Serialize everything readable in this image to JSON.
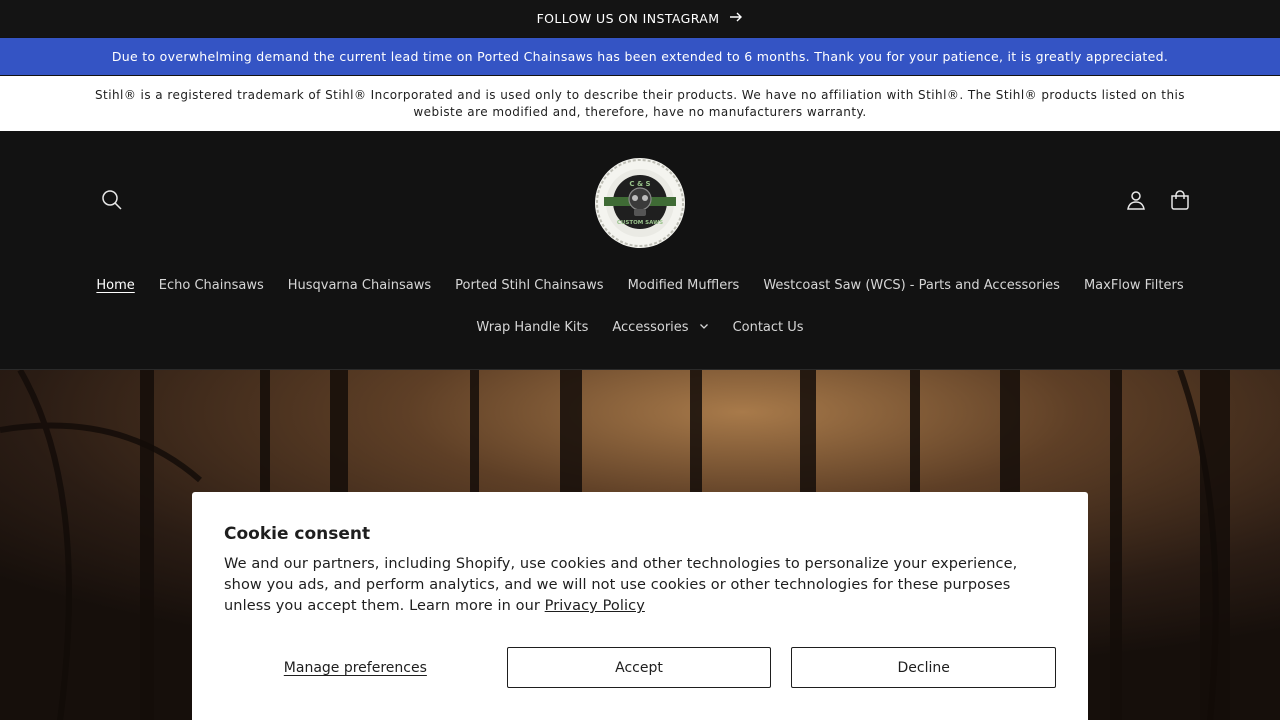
{
  "announcement": {
    "instagram_label": "FOLLOW US ON INSTAGRAM",
    "lead_time_notice": "Due to overwhelming demand the current lead time on Ported Chainsaws has been extended to 6 months. Thank you for your patience, it is greatly appreciated.",
    "trademark_notice": "Stihl® is a registered trademark of Stihl® Incorporated and is used only to describe their products. We have no affiliation with Stihl®. The Stihl® products listed on this webiste are modified and, therefore, have no manufacturers warranty."
  },
  "header": {
    "logo_text_top": "C & S",
    "logo_text_bottom": "CUSTOM SAWS",
    "icons": {
      "search": "search-icon",
      "account": "user-icon",
      "cart": "cart-icon"
    }
  },
  "nav": {
    "row1": [
      {
        "label": "Home",
        "active": true
      },
      {
        "label": "Echo Chainsaws"
      },
      {
        "label": "Husqvarna Chainsaws"
      },
      {
        "label": "Ported Stihl Chainsaws"
      },
      {
        "label": "Modified Mufflers"
      },
      {
        "label": "Westcoast Saw (WCS) - Parts and Accessories"
      },
      {
        "label": "MaxFlow Filters"
      }
    ],
    "row2": [
      {
        "label": "Wrap Handle Kits"
      },
      {
        "label": "Accessories",
        "has_dropdown": true
      },
      {
        "label": "Contact Us"
      }
    ]
  },
  "cookie": {
    "title": "Cookie consent",
    "body": "We and our partners, including Shopify, use cookies and other technologies to personalize your experience, show you ads, and perform analytics, and we will not use cookies or other technologies for these purposes unless you accept them. Learn more in our ",
    "policy_link": "Privacy Policy",
    "manage_label": "Manage preferences",
    "accept_label": "Accept",
    "decline_label": "Decline"
  },
  "colors": {
    "notice_bar": "#3454c4",
    "header_bg": "#121212",
    "modal_bg": "#ffffff"
  }
}
